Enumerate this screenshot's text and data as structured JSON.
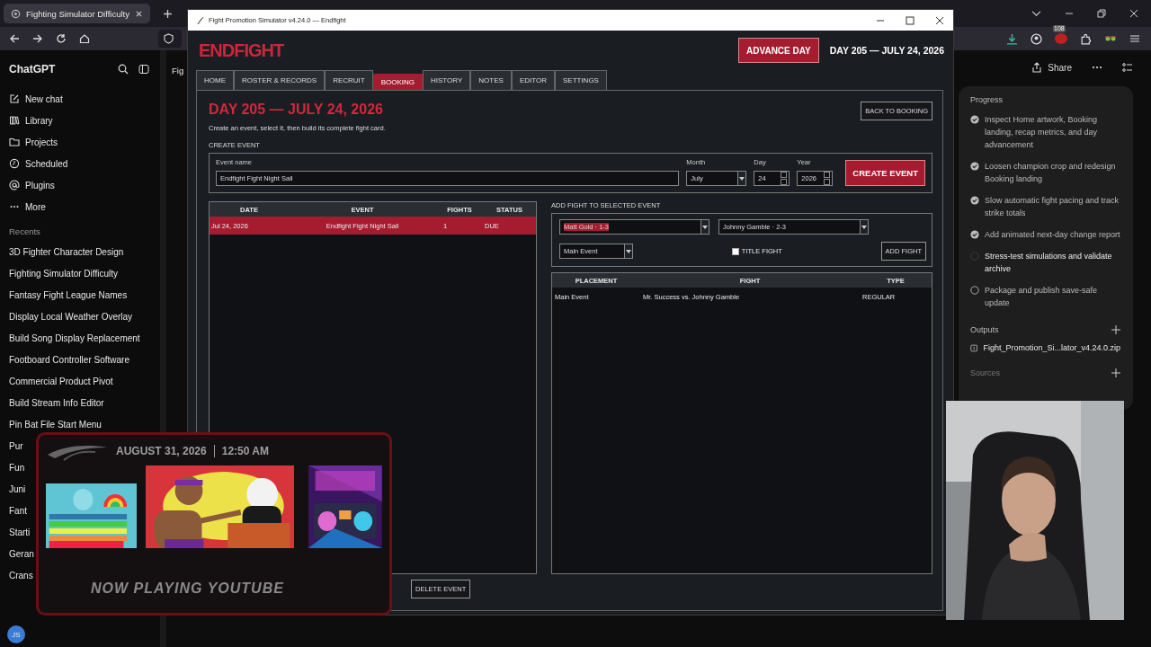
{
  "browser": {
    "tab_title": "Fighting Simulator Difficulty",
    "extension_badge": "108"
  },
  "chatgpt": {
    "title": "ChatGPT",
    "heading": "Fig",
    "share": "Share",
    "nav": [
      {
        "label": "New chat"
      },
      {
        "label": "Library"
      },
      {
        "label": "Projects"
      },
      {
        "label": "Scheduled"
      },
      {
        "label": "Plugins"
      },
      {
        "label": "More"
      }
    ],
    "recents_label": "Recents",
    "recents": [
      "3D Fighter Character Design",
      "Fighting Simulator Difficulty",
      "Fantasy Fight League Names",
      "Display Local Weather Overlay",
      "Build Song Display Replacement",
      "Footboard Controller Software",
      "Commercial Product Pivot",
      "Build Stream Info Editor",
      "Pin Bat File Start Menu",
      "Pur",
      "Fun",
      "Juni",
      "Fant",
      "Starti",
      "Geran",
      "Crans"
    ],
    "user_initials": "JS"
  },
  "progress": {
    "title": "Progress",
    "steps": [
      {
        "text": "Inspect Home artwork, Booking landing, recap metrics, and day advancement",
        "completed": true,
        "in_progress": false
      },
      {
        "text": "Loosen champion crop and redesign Booking landing",
        "completed": true,
        "in_progress": false
      },
      {
        "text": "Slow automatic fight pacing and track strike totals",
        "completed": true,
        "in_progress": false
      },
      {
        "text": "Add animated next-day change report",
        "completed": true,
        "in_progress": false
      },
      {
        "text": "Stress-test simulations and validate archive",
        "completed": false,
        "in_progress": true
      },
      {
        "text": "Package and publish save-safe update",
        "completed": false,
        "in_progress": false
      }
    ],
    "outputs_title": "Outputs",
    "output_file": "Fight_Promotion_Si...lator_v4.24.0.zip",
    "sources_title": "Sources"
  },
  "app": {
    "window_title": "Fight Promotion Simulator v4.24.0 — Endfight",
    "logo": "ENDFIGHT",
    "advance_button": "ADVANCE DAY",
    "current_date": "DAY 205 — JULY 24, 2026",
    "tabs": [
      {
        "label": "HOME",
        "selected": false
      },
      {
        "label": "ROSTER & RECORDS",
        "selected": false
      },
      {
        "label": "RECRUIT",
        "selected": false
      },
      {
        "label": "BOOKING",
        "selected": true
      },
      {
        "label": "HISTORY",
        "selected": false
      },
      {
        "label": "NOTES",
        "selected": false
      },
      {
        "label": "EDITOR",
        "selected": false
      },
      {
        "label": "SETTINGS",
        "selected": false
      }
    ],
    "heading": "DAY 205 — JULY 24, 2026",
    "subtitle": "Create an event, select it, then build its complete fight card.",
    "back_button": "BACK TO BOOKING",
    "create_event": {
      "title": "CREATE EVENT",
      "name_label": "Event name",
      "name_value": "Endfight Fight Night Sail",
      "month_label": "Month",
      "month": "July",
      "day_label": "Day",
      "day": "24",
      "year_label": "Year",
      "year": "2026",
      "button": "CREATE EVENT"
    },
    "events_table": {
      "columns": [
        "DATE",
        "EVENT",
        "FIGHTS",
        "STATUS"
      ],
      "rows": [
        {
          "cells": [
            "Jul 24, 2026",
            "Endfight Fight Night Sail",
            "1",
            "DUE"
          ],
          "selected": true
        }
      ]
    },
    "add_fight": {
      "title": "ADD FIGHT TO SELECTED EVENT",
      "fighter_a": "Matt Gold · 1-3",
      "fighter_a_highlighted": true,
      "fighter_b": "Johnny Gamble · 2-3",
      "placement": "Main Event",
      "title_fight": {
        "label": "TITLE FIGHT",
        "checked": false
      },
      "button": "ADD FIGHT"
    },
    "fights_table": {
      "columns": [
        "PLACEMENT",
        "FIGHT",
        "TYPE"
      ],
      "rows": [
        {
          "cells": [
            "Main Event",
            "Mr. Success vs. Johnny Gamble",
            "REGULAR"
          ]
        }
      ]
    },
    "delete_button": "DELETE EVENT"
  },
  "overlay": {
    "date": "AUGUST 31, 2026",
    "time": "12:50 AM",
    "now_playing": "NOW PLAYING YOUTUBE"
  }
}
